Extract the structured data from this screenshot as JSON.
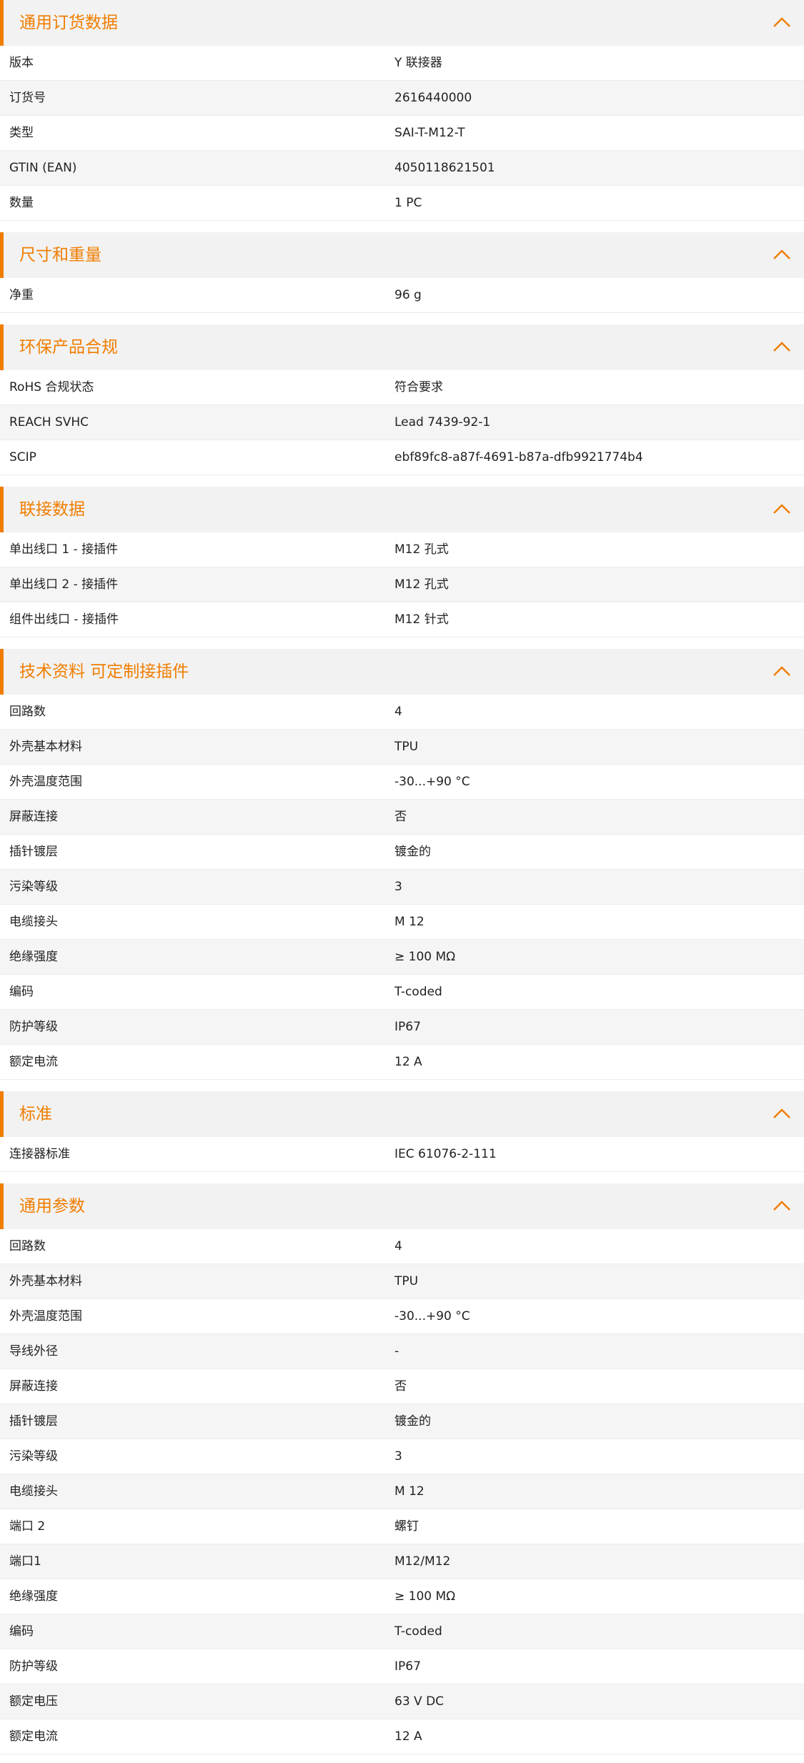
{
  "colors": {
    "accent": "#f07d00",
    "header_bg": "#f2f2f2",
    "row_alt_bg": "#f5f5f5"
  },
  "icons": {
    "section_toggle": "chevron-up-icon"
  },
  "sections": [
    {
      "title": "通用订货数据",
      "rows": [
        {
          "label": "版本",
          "value": "Y 联接器"
        },
        {
          "label": "订货号",
          "value": "2616440000"
        },
        {
          "label": "类型",
          "value": "SAI-T-M12-T"
        },
        {
          "label": "GTIN (EAN)",
          "value": "4050118621501"
        },
        {
          "label": "数量",
          "value": "1  PC"
        }
      ]
    },
    {
      "title": "尺寸和重量",
      "rows": [
        {
          "label": "净重",
          "value": "96  g"
        }
      ]
    },
    {
      "title": "环保产品合规",
      "rows": [
        {
          "label": "RoHS 合规状态",
          "value": "符合要求"
        },
        {
          "label": "REACH SVHC",
          "value": "Lead 7439-92-1"
        },
        {
          "label": "SCIP",
          "value": "ebf89fc8-a87f-4691-b87a-dfb9921774b4"
        }
      ]
    },
    {
      "title": "联接数据",
      "rows": [
        {
          "label": "单出线口 1 - 接插件",
          "value": "M12 孔式"
        },
        {
          "label": "单出线口 2 - 接插件",
          "value": "M12 孔式"
        },
        {
          "label": "组件出线口 - 接插件",
          "value": "M12 针式"
        }
      ]
    },
    {
      "title": "技术资料 可定制接插件",
      "rows": [
        {
          "label": "回路数",
          "value": "4"
        },
        {
          "label": "外壳基本材料",
          "value": "TPU"
        },
        {
          "label": "外壳温度范围",
          "value": "-30...+90 °C"
        },
        {
          "label": "屏蔽连接",
          "value": "否"
        },
        {
          "label": "插针镀层",
          "value": "镀金的"
        },
        {
          "label": "污染等级",
          "value": "3"
        },
        {
          "label": "电缆接头",
          "value": "M 12"
        },
        {
          "label": "绝缘强度",
          "value": "≥ 100 MΩ"
        },
        {
          "label": "编码",
          "value": "T-coded"
        },
        {
          "label": "防护等级",
          "value": "IP67"
        },
        {
          "label": "额定电流",
          "value": "12  A"
        }
      ]
    },
    {
      "title": "标准",
      "rows": [
        {
          "label": "连接器标准",
          "value": "IEC 61076-2-111"
        }
      ]
    },
    {
      "title": "通用参数",
      "rows": [
        {
          "label": "回路数",
          "value": "4"
        },
        {
          "label": "外壳基本材料",
          "value": "TPU"
        },
        {
          "label": "外壳温度范围",
          "value": "-30...+90 °C"
        },
        {
          "label": "导线外径",
          "value": "-"
        },
        {
          "label": "屏蔽连接",
          "value": "否"
        },
        {
          "label": "插针镀层",
          "value": "镀金的"
        },
        {
          "label": "污染等级",
          "value": "3"
        },
        {
          "label": "电缆接头",
          "value": "M 12"
        },
        {
          "label": "端口 2",
          "value": "螺钉"
        },
        {
          "label": "端口1",
          "value": "M12/M12"
        },
        {
          "label": "绝缘强度",
          "value": "≥ 100 MΩ"
        },
        {
          "label": "编码",
          "value": "T-coded"
        },
        {
          "label": "防护等级",
          "value": "IP67"
        },
        {
          "label": "额定电压",
          "value": "63 V DC"
        },
        {
          "label": "额定电流",
          "value": "12  A"
        }
      ]
    }
  ]
}
